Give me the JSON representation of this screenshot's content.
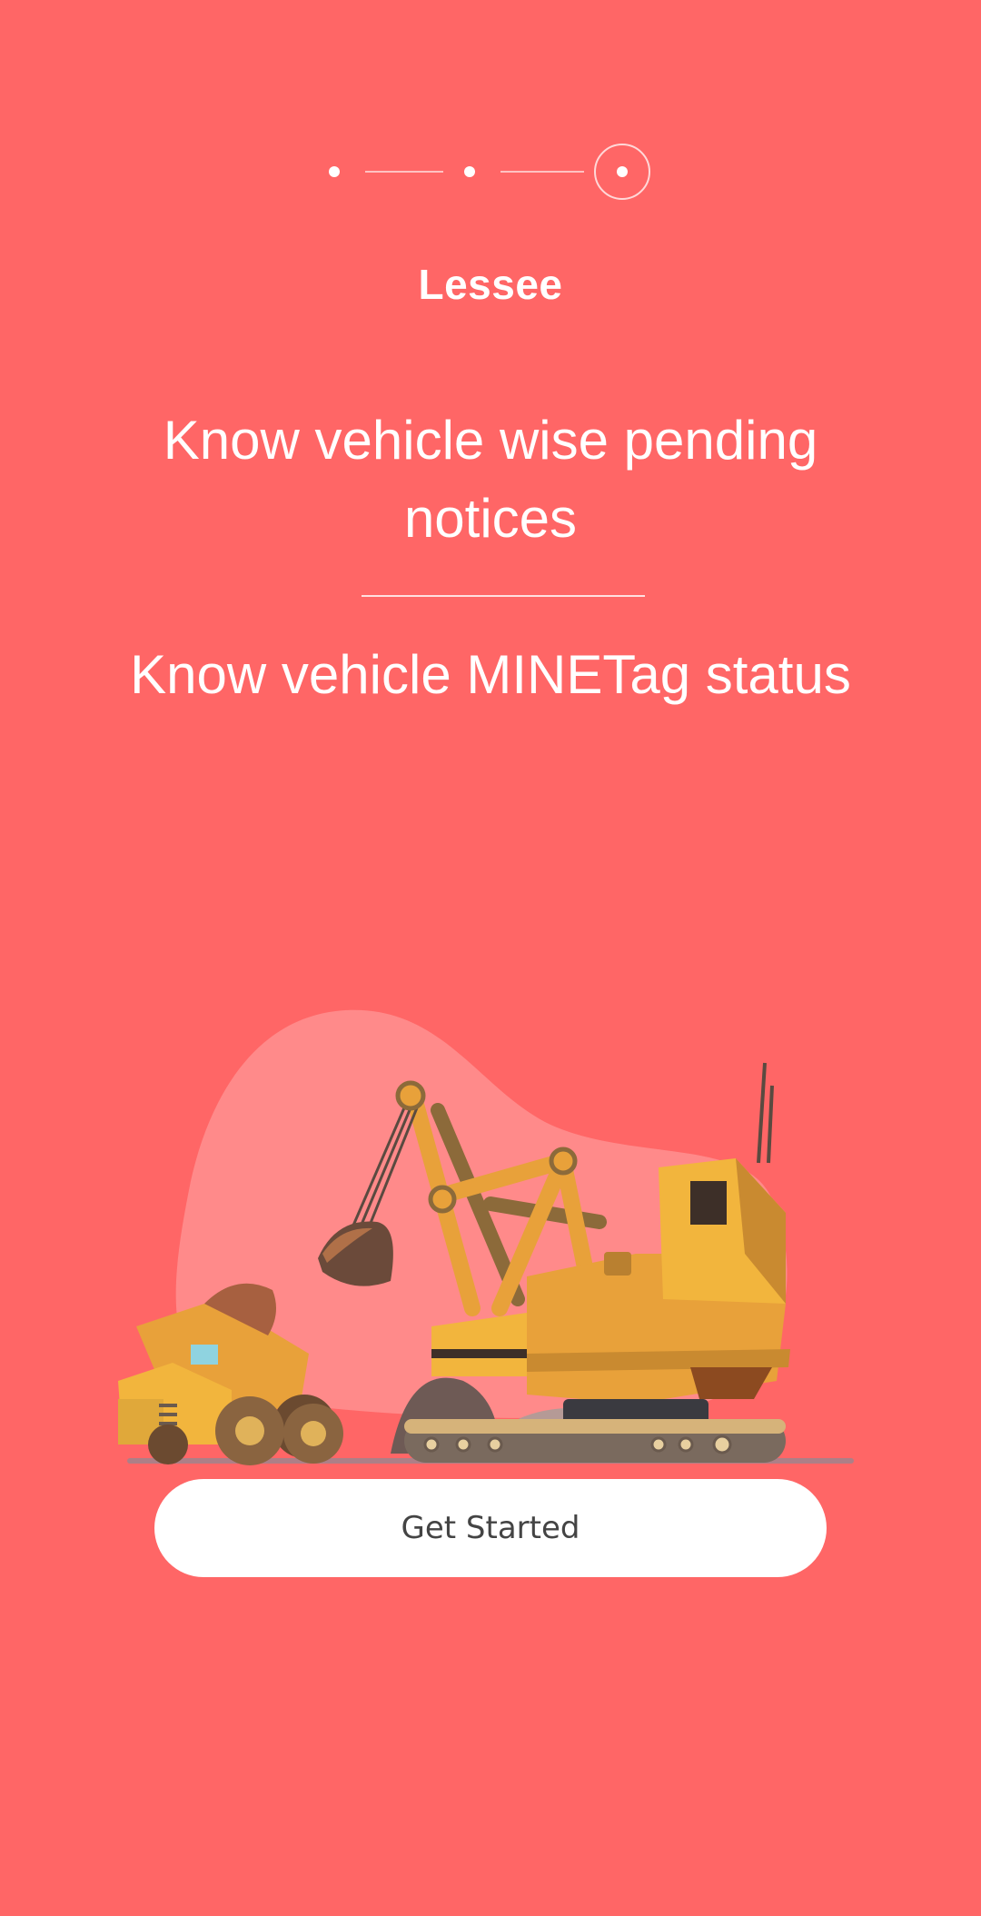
{
  "onboarding": {
    "step_count": 3,
    "current_step": 3,
    "role_title": "Lessee",
    "features": [
      "Know vehicle wise pending notices",
      "Know vehicle MINETag status"
    ],
    "illustration": "mining-excavator-and-dump-truck",
    "cta_label": "Get Started"
  },
  "colors": {
    "background": "#FF6666",
    "blob": "#FF8A8A",
    "button_bg": "#FFFFFF",
    "button_text": "#444444",
    "text": "#FFFFFF"
  }
}
